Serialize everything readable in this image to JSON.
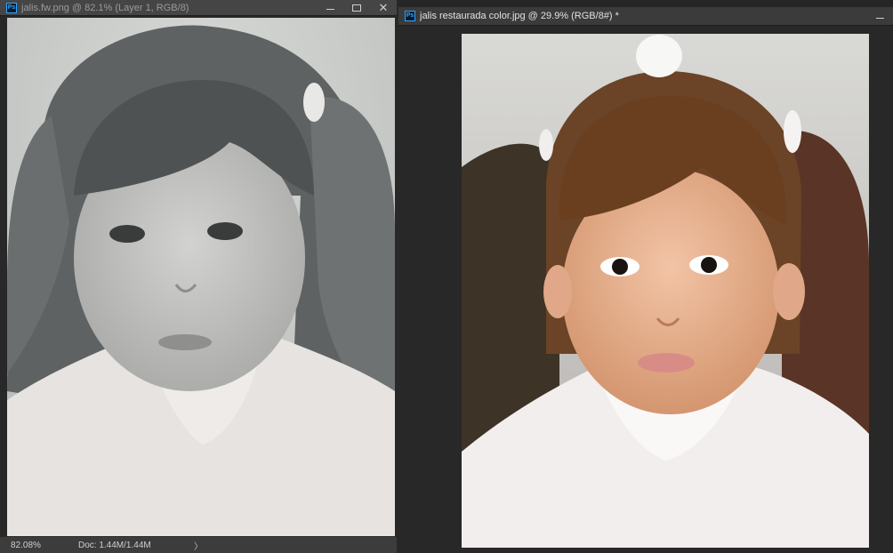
{
  "windows": {
    "left": {
      "title": "jalis.fw.png @ 82.1% (Layer 1, RGB/8)",
      "app_icon_text": "Ps",
      "status": {
        "zoom": "82.08%",
        "doc": "Doc: 1.44M/1.44M",
        "arrow": "〉"
      }
    },
    "right": {
      "title": "jalis restaurada color.jpg @ 29.9% (RGB/8#) *",
      "app_icon_text": "Ps"
    }
  },
  "icons": {
    "minimize": "minimize-icon",
    "restore": "restore-icon",
    "close": "close-icon",
    "close_glyph": "✕"
  },
  "colors": {
    "workspace": "#282828",
    "titlebar": "#454545",
    "photoshop_blue": "#31a8ff"
  }
}
